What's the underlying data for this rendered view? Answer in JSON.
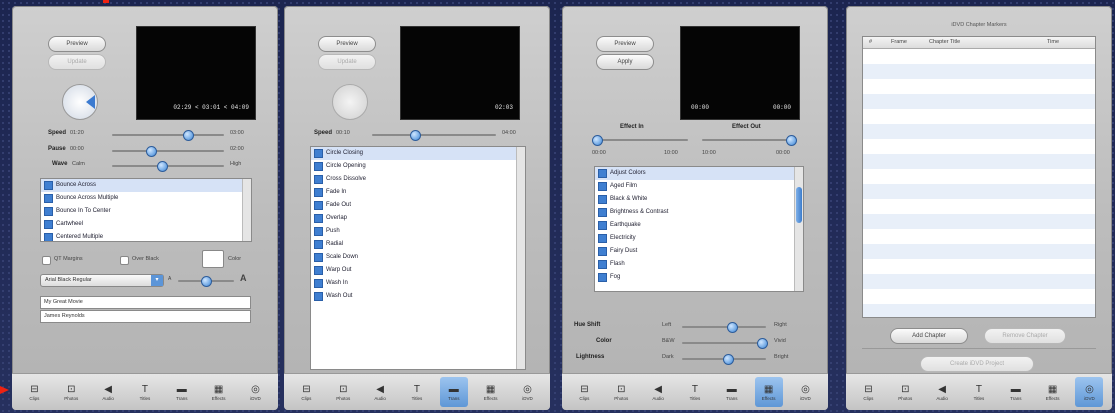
{
  "toolbar_items": [
    {
      "label": "Clips",
      "icon": "clips-icon",
      "glyph": "⊟"
    },
    {
      "label": "Photos",
      "icon": "photos-icon",
      "glyph": "⊡"
    },
    {
      "label": "Audio",
      "icon": "audio-icon",
      "glyph": "◀"
    },
    {
      "label": "Titles",
      "icon": "titles-icon",
      "glyph": "T"
    },
    {
      "label": "Trans",
      "icon": "transitions-icon",
      "glyph": "▬"
    },
    {
      "label": "Effects",
      "icon": "effects-icon",
      "glyph": "▦"
    },
    {
      "label": "iDVD",
      "icon": "idvd-icon",
      "glyph": "◎"
    }
  ],
  "titles_panel": {
    "preview_label": "Preview",
    "update_label": "Update",
    "timecode": "02:29  <  03:01  <  04:09",
    "speed_label": "Speed",
    "speed_min": "01:20",
    "speed_max": "03:00",
    "speed_value": 0.68,
    "pause_label": "Pause",
    "pause_min": "00:00",
    "pause_max": "02:00",
    "pause_value": 0.35,
    "wave_label": "Wave",
    "wave_min": "Calm",
    "wave_max": "High",
    "wave_value": 0.45,
    "items": [
      "Bounce Across",
      "Bounce Across Multiple",
      "Bounce In To Center",
      "Cartwheel",
      "Centered Multiple"
    ],
    "qt_margins_label": "QT Margins",
    "over_black_label": "Over Black",
    "color_label": "Color",
    "font_label": "Arial Black Regular",
    "small_a": "A",
    "large_a": "A",
    "font_size_value": 0.5,
    "text_line1": "My Great Movie",
    "text_line2": "James Reynolds"
  },
  "transitions_panel": {
    "preview_label": "Preview",
    "update_label": "Update",
    "timecode": "02:03",
    "speed_label": "Speed",
    "speed_min": "00:10",
    "speed_max": "04:00",
    "speed_value": 0.35,
    "items": [
      "Circle Closing",
      "Circle Opening",
      "Cross Dissolve",
      "Fade In",
      "Fade Out",
      "Overlap",
      "Push",
      "Radial",
      "Scale Down",
      "Warp Out",
      "Wash In",
      "Wash Out"
    ]
  },
  "effects_panel": {
    "preview_label": "Preview",
    "apply_label": "Apply",
    "tc_left": "00:00",
    "tc_right": "00:00",
    "effect_in_label": "Effect In",
    "effect_out_label": "Effect Out",
    "in_min": "00:00",
    "in_max": "10:00",
    "out_min": "10:00",
    "out_max": "00:00",
    "items": [
      "Adjust Colors",
      "Aged Film",
      "Black & White",
      "Brightness & Contrast",
      "Earthquake",
      "Electricity",
      "Fairy Dust",
      "Flash",
      "Fog"
    ],
    "hue_label": "Hue Shift",
    "hue_min": "Left",
    "hue_max": "Right",
    "hue_value": 0.6,
    "color_label": "Color",
    "color_min": "B&W",
    "color_max": "Vivid",
    "color_value": 0.95,
    "lightness_label": "Lightness",
    "lightness_min": "Dark",
    "lightness_max": "Bright",
    "lightness_value": 0.55
  },
  "idvd_panel": {
    "title": "iDVD Chapter Markers",
    "columns": [
      "#",
      "Frame",
      "Chapter Title",
      "Time"
    ],
    "add_label": "Add Chapter",
    "remove_label": "Remove Chapter",
    "create_label": "Create iDVD Project"
  },
  "colors": {
    "accent": "#3b86d6",
    "active_tab": "#5f97d6",
    "arrow": "#e21"
  }
}
